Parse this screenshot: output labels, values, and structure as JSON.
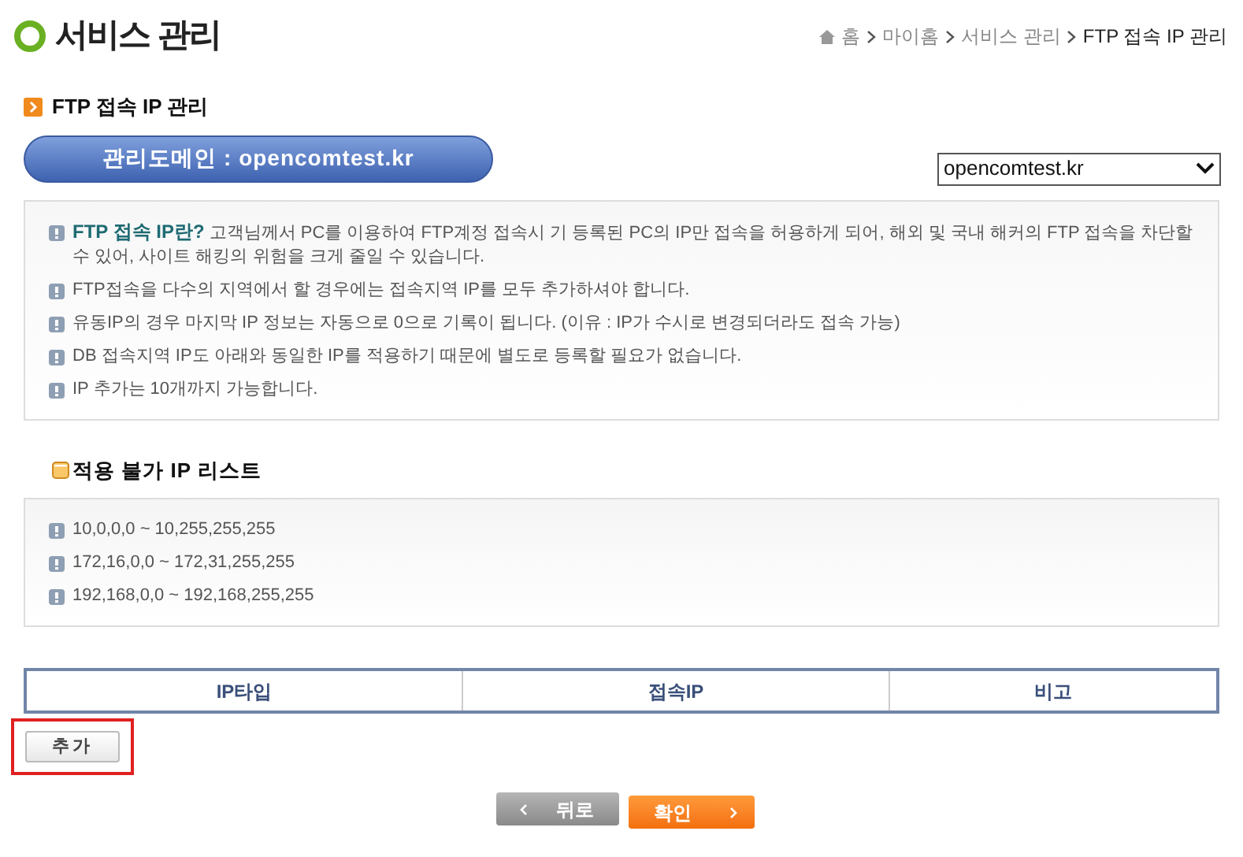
{
  "header": {
    "title": "서비스 관리",
    "breadcrumb": [
      "홈",
      "마이홈",
      "서비스 관리",
      "FTP 접속 IP 관리"
    ]
  },
  "section": {
    "title": "FTP 접속 IP 관리"
  },
  "domain_banner": "관리도메인 : opencomtest.kr",
  "domain_select": {
    "value": "opencomtest.kr"
  },
  "notices": [
    "**FTP 접속 IP란?** 고객님께서 PC를 이용하여 FTP계정 접속시 기 등록된 PC의 IP만 접속을 허용하게 되어, 해외 및 국내 해커의 FTP 접속을 차단할 수 있어, 사이트 해킹의 위험을 크게 줄일 수 있습니다.",
    "FTP접속을 다수의 지역에서 할 경우에는 접속지역 IP를 모두 추가하셔야 합니다.",
    "유동IP의 경우 마지막 IP 정보는 자동으로 0으로 기록이 됩니다. (이유 : IP가 수시로 변경되더라도 접속 가능)",
    "DB 접속지역 IP도 아래와 동일한 IP를 적용하기 때문에 별도로 등록할 필요가 없습니다.",
    "IP 추가는 10개까지 가능합니다."
  ],
  "blocked_list": {
    "title": "적용 불가 IP 리스트",
    "items": [
      "10,0,0,0 ~ 10,255,255,255",
      "172,16,0,0 ~ 172,31,255,255",
      "192,168,0,0 ~ 192,168,255,255"
    ]
  },
  "table": {
    "columns": [
      "IP타입",
      "접속IP",
      "비고"
    ]
  },
  "add_button": {
    "label": "추가",
    "highlighted": true
  },
  "buttons": [
    {
      "label": "뒤로",
      "kind": "back"
    },
    {
      "label": "확인",
      "kind": "confirm"
    }
  ]
}
